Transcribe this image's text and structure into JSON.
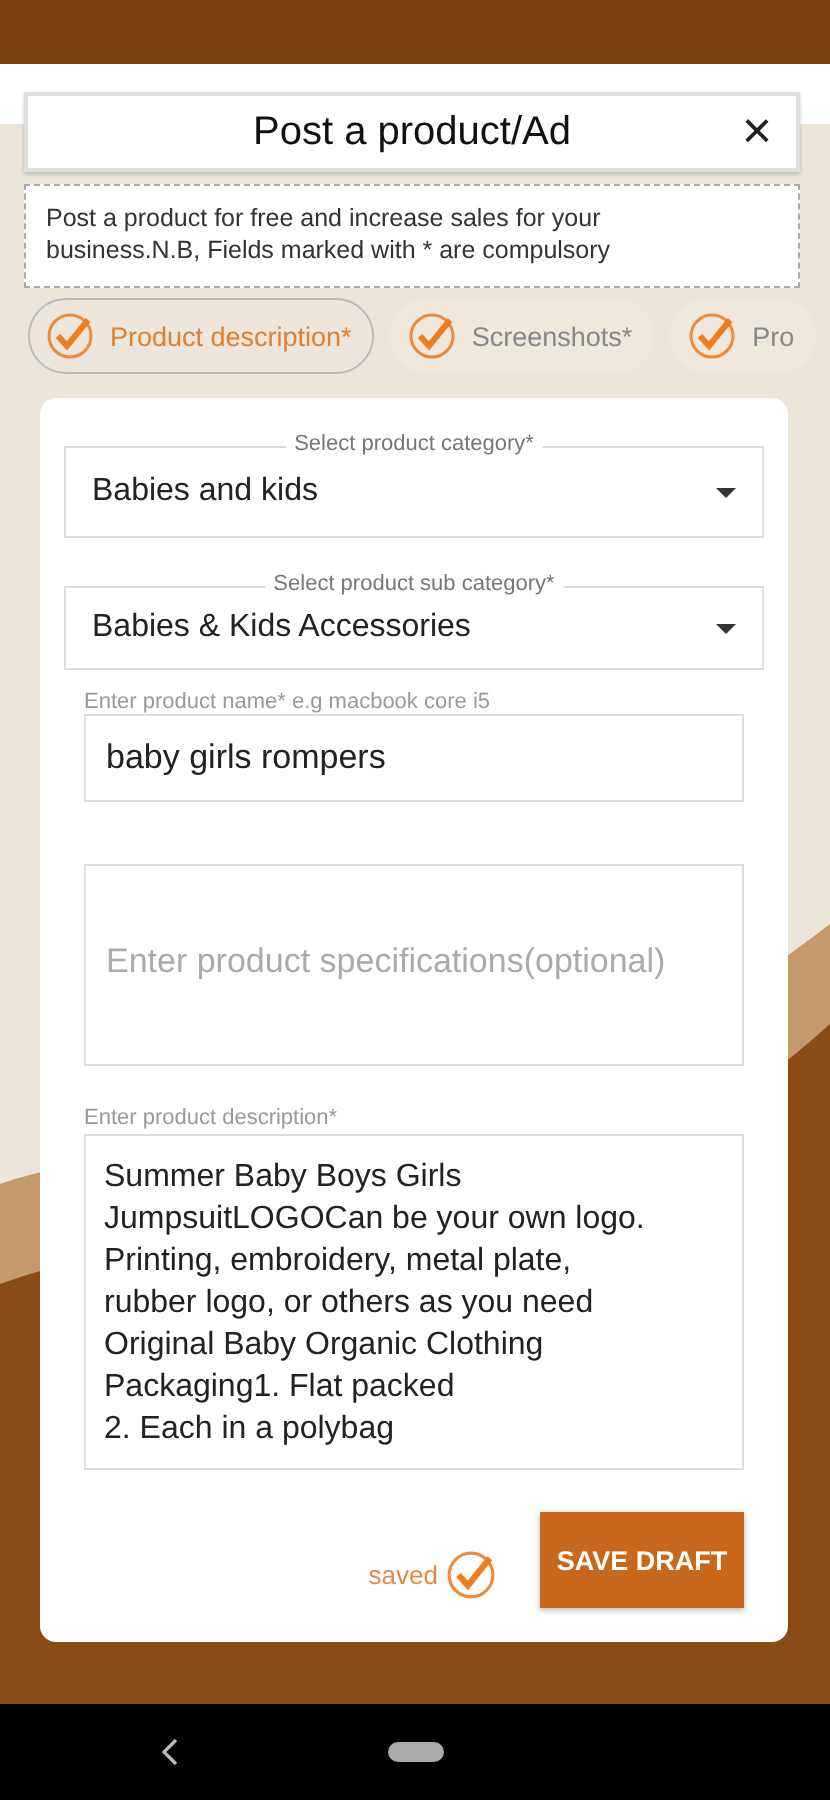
{
  "header": {
    "title": "Post a product/Ad",
    "close": "×"
  },
  "notice": "Post a product for free and increase sales for your business.N.B, Fields marked with * are compulsory",
  "steps": [
    {
      "label": "Product description*",
      "selected": true
    },
    {
      "label": "Screenshots*",
      "selected": false
    },
    {
      "label": "Pro",
      "selected": false
    }
  ],
  "form": {
    "category": {
      "label": "Select product category*",
      "value": "Babies and kids"
    },
    "sub_category": {
      "label": "Select product sub category*",
      "value": "Babies & Kids Accessories"
    },
    "name": {
      "label": "Enter product name* e.g macbook core i5",
      "value": "baby girls rompers"
    },
    "specifications": {
      "placeholder": "Enter product specifications(optional)"
    },
    "description": {
      "label": "Enter product description*",
      "value": "Summer Baby Boys Girls\nJumpsuitLOGOCan be your own logo.\nPrinting, embroidery, metal plate,\nrubber logo, or others as you need\nOriginal Baby Organic Clothing\nPackaging1. Flat packed\n2. Each in a polybag"
    }
  },
  "saved": {
    "label": "saved",
    "checked": true
  },
  "save_button": "SAVE DRAFT"
}
